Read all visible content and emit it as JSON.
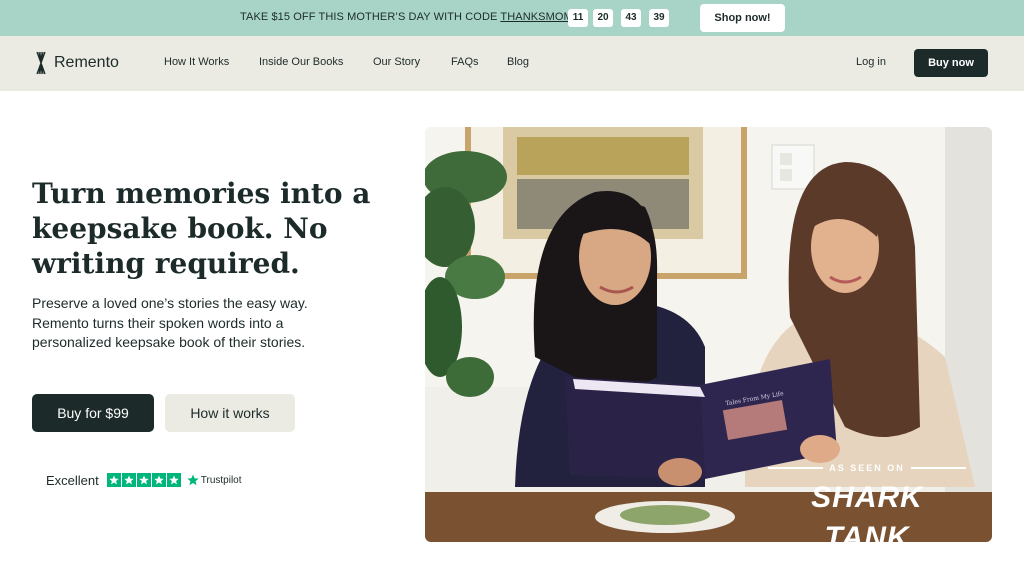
{
  "promo": {
    "text": "TAKE $15 OFF THIS MOTHER’S DAY WITH CODE ",
    "code": "THANKSMOM",
    "countdown": [
      "11",
      "20",
      "43",
      "39"
    ],
    "shop_label": "Shop now!"
  },
  "nav": {
    "logo_text": "Remento",
    "links": [
      "How It Works",
      "Inside Our Books",
      "Our Story",
      "FAQs",
      "Blog"
    ],
    "login_label": "Log in",
    "buy_label": "Buy now"
  },
  "hero": {
    "title": "Turn memories into a keepsake book. No writing required.",
    "subtitle": "Preserve a loved one’s stories the easy way. Remento turns their spoken words into a personalized keepsake book of their stories.",
    "primary_button": "Buy for $99",
    "secondary_button": "How it works",
    "rating_label": "Excellent",
    "rating_stars": 5,
    "rating_brand": "Trustpilot"
  },
  "photo": {
    "book_title": "Tales From My Life",
    "badge_top": "AS SEEN ON",
    "badge_main": "SHARK TANK"
  },
  "colors": {
    "promo_bg": "#a8d4c8",
    "nav_bg": "#ecebe3",
    "dark": "#1c2b2a",
    "trustpilot_green": "#00b67a"
  }
}
